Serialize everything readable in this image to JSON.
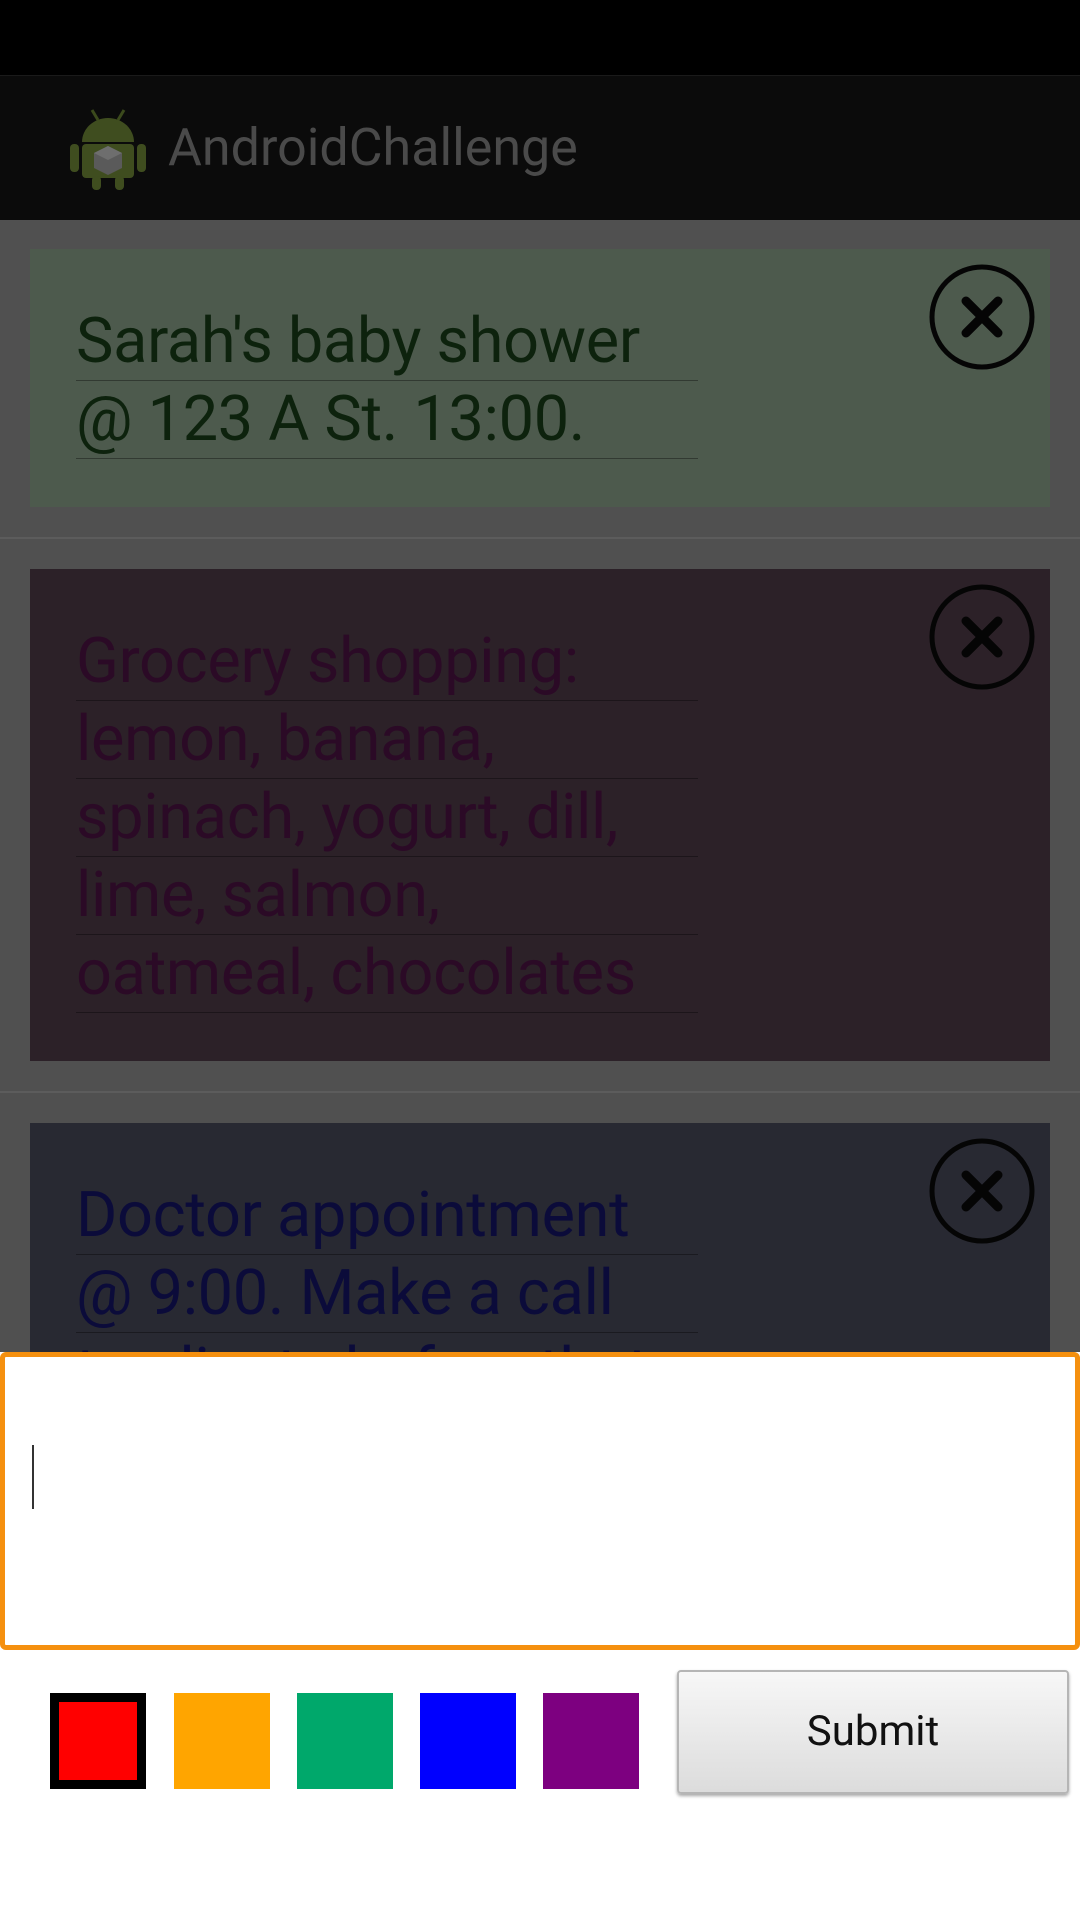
{
  "app": {
    "title": "AndroidChallenge"
  },
  "notes": [
    {
      "text_lines": [
        "Sarah's baby shower",
        "@ 123 A St. 13:00."
      ]
    },
    {
      "text_lines": [
        "Grocery shopping:",
        "lemon, banana,",
        "spinach, yogurt, dill,",
        "lime, salmon,",
        "oatmeal, chocolates"
      ]
    },
    {
      "text_lines": [
        "Doctor appointment",
        "@ 9:00. Make a call",
        "to clients before that."
      ]
    }
  ],
  "composer": {
    "input_value": "",
    "colors": {
      "red": "#ff0000",
      "orange": "#ffa500",
      "green": "#00a86b",
      "blue": "#0000ff",
      "purple": "#7d0080"
    },
    "selected_color": "red",
    "submit_label": "Submit"
  },
  "icons": {
    "close": "close-circle-icon",
    "app": "android-app-icon"
  }
}
